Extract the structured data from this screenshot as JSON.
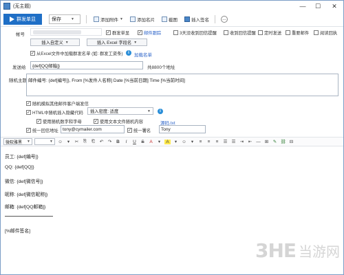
{
  "window": {
    "title": "(无主题)",
    "minimize": "—",
    "maximize": "☐",
    "close": "✕"
  },
  "toolbar": {
    "send": "群发单显",
    "save": "保存",
    "attach": "添加附件",
    "card": "添加名片",
    "screenshot": "截图",
    "signature": "插入签名",
    "more": "…"
  },
  "fields": {
    "account_label": "帐号",
    "options": {
      "mass_send": "群发单显",
      "mail_tracking": "邮件跟踪",
      "auto_remind": "3天没收到回信提醒",
      "read_receipt": "收到回信提醒",
      "scheduled": "定时发送",
      "important": "重要邮件",
      "read_confirm": "阅读回执"
    },
    "insert_custom": "插入自定义",
    "insert_excel": "插入 Excel 字段名",
    "load_excel": "从Excel文件中加载群发名单 (如: 群发工资条)",
    "load_list_link": "加载名单",
    "to_label": "发送给",
    "to_value": "{def[QQ邮箱]}",
    "to_count": "共8800个地址",
    "subject_label": "随机主题",
    "subject_value": "邮件编号: {def[编号]}, From [%发件人名称] Date [%当前日期] Time [%当前时间]",
    "rand_simulate": "随机模拟其他邮件客户端发信",
    "html_hidden": "HTML中随机插入隐藏代码",
    "insert_density": "插入密度: 适度",
    "rand_digits": "使用随机数字和字母",
    "text_file": "使用文本文件随机内容",
    "source_link": "源码.txt",
    "reply_label": "统一回信地址",
    "reply_value": "tony@cymailer.com",
    "signature_label": "统一署名",
    "signature_value": "Tony"
  },
  "format_bar": {
    "font": "微软雅黑",
    "size": "",
    "icons": [
      "☺",
      "▾",
      "✂",
      "⎘",
      "⎗",
      "↶",
      "↷",
      "B",
      "I",
      "U",
      "S",
      "A",
      "▾",
      "A",
      "▾",
      "☺",
      "▾",
      "≡",
      "≡",
      "≡",
      "☰",
      "☰",
      "⇥",
      "⇤",
      "—",
      "⊞",
      "✎",
      "⛓",
      "⊟"
    ]
  },
  "body_lines": [
    "员工: {def[编号]}",
    "QQ: {def[QQ]}",
    "微信: {def[微信号]}",
    "昵称: {def[微信昵称]}",
    "邮箱: {def[QQ邮箱]}",
    "[%邮件签名]"
  ],
  "watermark": {
    "brand": "3HE",
    "cn": "当游网"
  },
  "colors": {
    "accent": "#1f6fc6",
    "link": "#2a62c8",
    "info": "#2a8ed8"
  }
}
